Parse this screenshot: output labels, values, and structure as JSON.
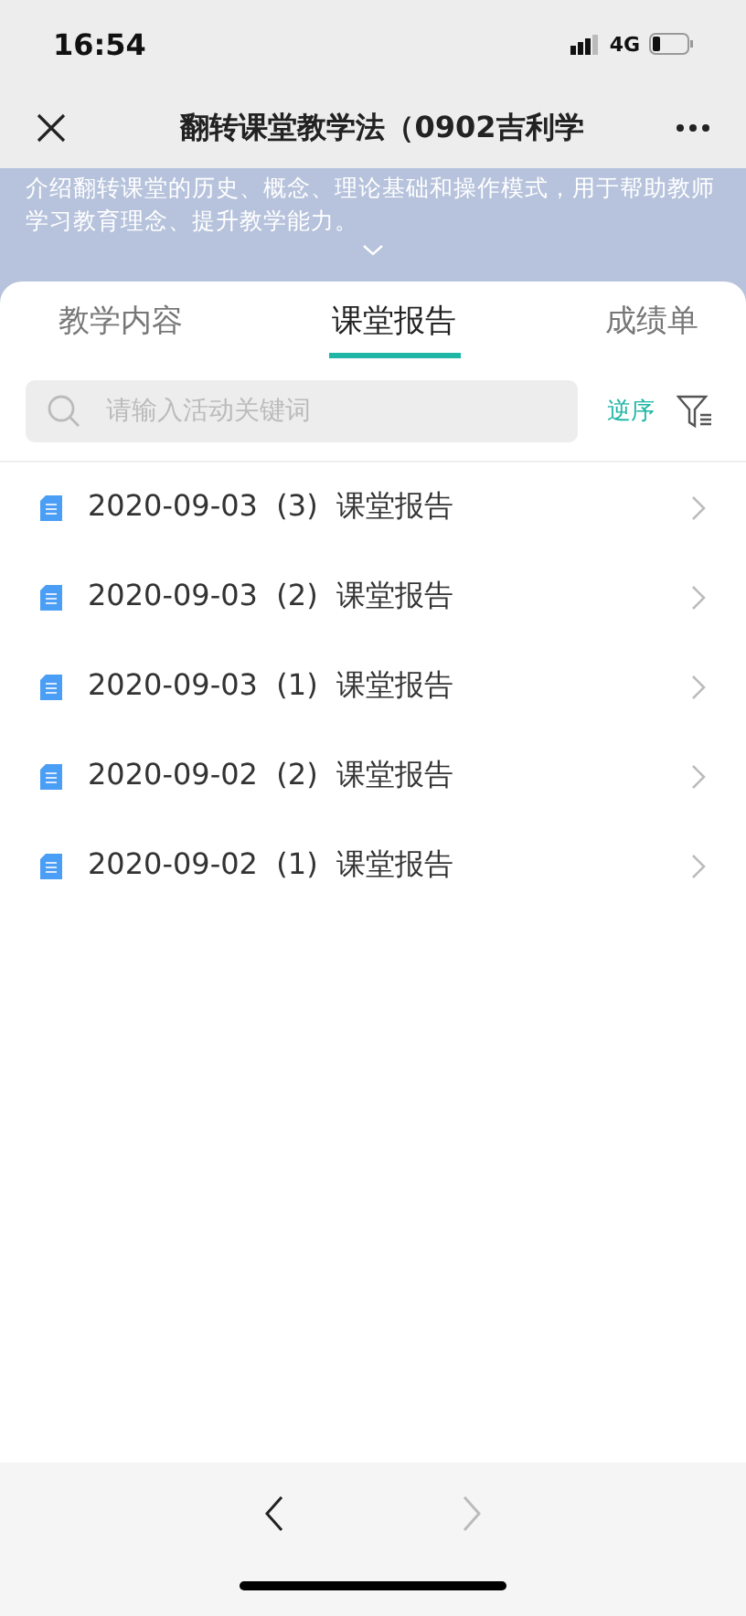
{
  "status_bar": {
    "time": "16:54",
    "network": "4G"
  },
  "nav_bar": {
    "title": "翻转课堂教学法（0902吉利学"
  },
  "banner": {
    "description": "介绍翻转课堂的历史、概念、理论基础和操作模式，用于帮助教师学习教育理念、提升教学能力。"
  },
  "tabs": [
    {
      "label": "教学内容",
      "selected": false
    },
    {
      "label": "课堂报告",
      "selected": true
    },
    {
      "label": "成绩单",
      "selected": false
    }
  ],
  "search": {
    "placeholder": "请输入活动关键词"
  },
  "sort_link": "逆序",
  "reports": [
    {
      "title": "2020-09-03  (3)  课堂报告"
    },
    {
      "title": "2020-09-03  (2)  课堂报告"
    },
    {
      "title": "2020-09-03  (1)  课堂报告"
    },
    {
      "title": "2020-09-02  (2)  课堂报告"
    },
    {
      "title": "2020-09-02  (1)  课堂报告"
    }
  ],
  "bottom_nav": {
    "back": {
      "disabled": false
    },
    "forward": {
      "disabled": true
    }
  }
}
